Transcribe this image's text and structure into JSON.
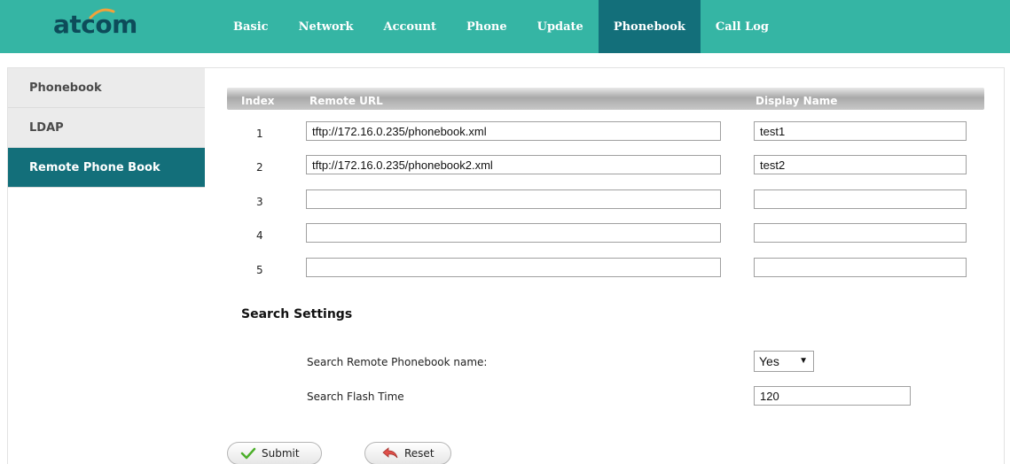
{
  "brand": {
    "logo_text": "atcom"
  },
  "nav": {
    "tabs": [
      {
        "label": "Basic"
      },
      {
        "label": "Network"
      },
      {
        "label": "Account"
      },
      {
        "label": "Phone"
      },
      {
        "label": "Update"
      },
      {
        "label": "Phonebook",
        "active": true
      },
      {
        "label": "Call Log"
      }
    ]
  },
  "sidebar": {
    "items": [
      {
        "label": "Phonebook"
      },
      {
        "label": "LDAP"
      },
      {
        "label": "Remote Phone Book",
        "active": true
      }
    ]
  },
  "table": {
    "headers": {
      "index": "Index",
      "url": "Remote URL",
      "name": "Display Name"
    },
    "rows": [
      {
        "index": "1",
        "url": "tftp://172.16.0.235/phonebook.xml",
        "name": "test1"
      },
      {
        "index": "2",
        "url": "tftp://172.16.0.235/phonebook2.xml",
        "name": "test2"
      },
      {
        "index": "3",
        "url": "",
        "name": ""
      },
      {
        "index": "4",
        "url": "",
        "name": ""
      },
      {
        "index": "5",
        "url": "",
        "name": ""
      }
    ]
  },
  "search": {
    "title": "Search Settings",
    "remote_name_label": "Search Remote Phonebook name:",
    "remote_name_value": "Yes",
    "flash_time_label": "Search Flash Time",
    "flash_time_value": "120"
  },
  "buttons": {
    "submit": "Submit",
    "reset": "Reset"
  },
  "colors": {
    "header_bar": "#35b5a4",
    "active": "#136f7a",
    "logo": "#0d4c5a",
    "accent_orange": "#f2a23a"
  }
}
